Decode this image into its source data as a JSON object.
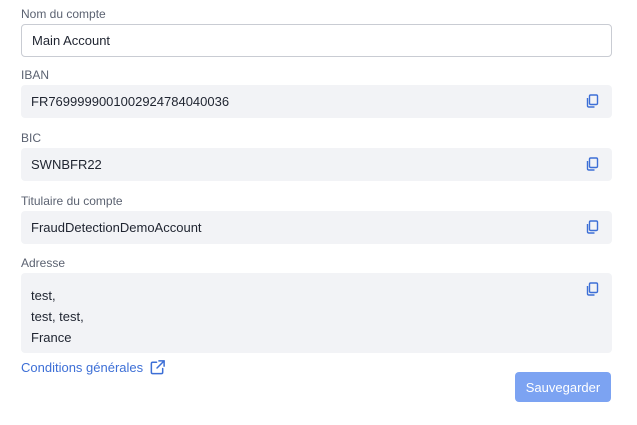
{
  "account_name": {
    "label": "Nom du compte",
    "value": "Main Account"
  },
  "iban": {
    "label": "IBAN",
    "value": "FR7699999001002924784040036"
  },
  "bic": {
    "label": "BIC",
    "value": "SWNBFR22"
  },
  "holder": {
    "label": "Titulaire du compte",
    "value": "FraudDetectionDemoAccount"
  },
  "address": {
    "label": "Adresse",
    "lines": [
      "test,",
      "test, test,",
      "France"
    ]
  },
  "terms_link": {
    "label": "Conditions générales",
    "icon": "external-link-icon"
  },
  "save_button": {
    "label": "Sauvegarder"
  },
  "colors": {
    "accent": "#3d6fd6",
    "button": "#7ca3f2",
    "field_bg": "#f2f3f6"
  }
}
